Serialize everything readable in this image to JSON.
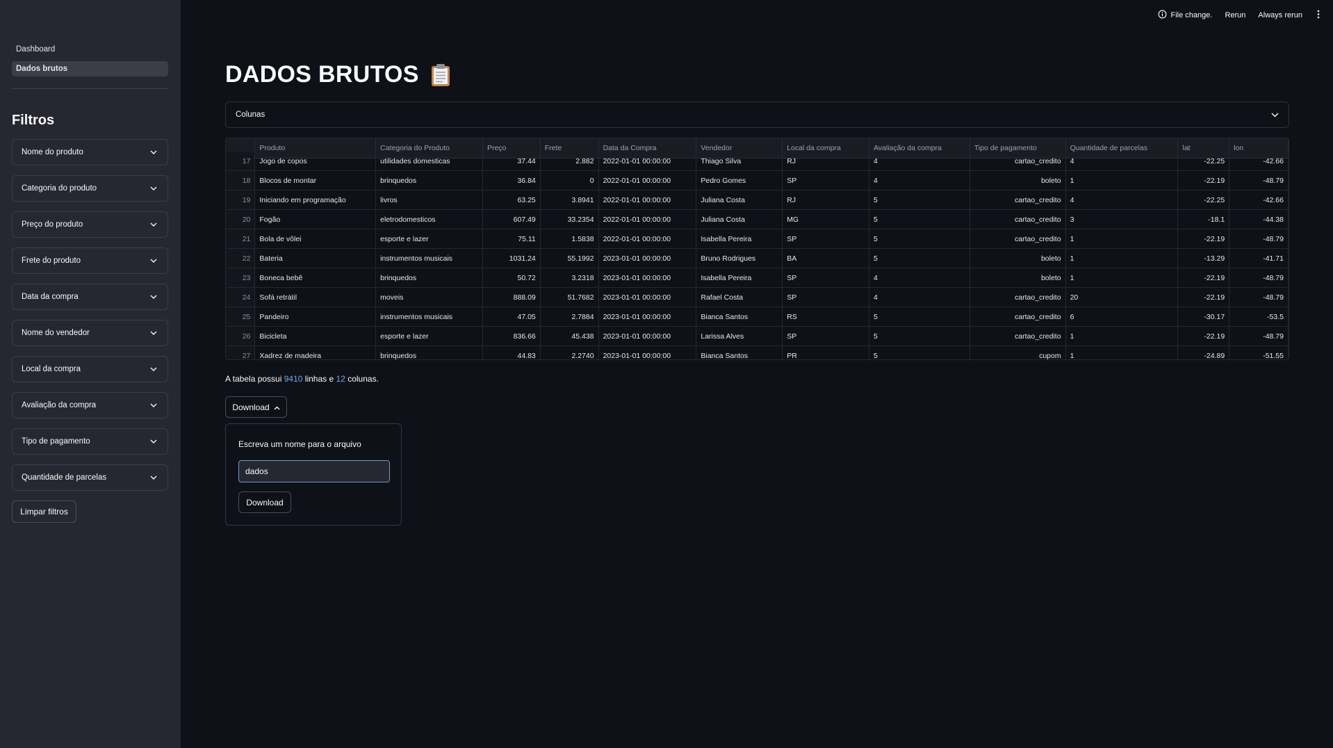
{
  "sidebar": {
    "nav": [
      "Dashboard",
      "Dados brutos"
    ],
    "filters_title": "Filtros",
    "filters": [
      "Nome do produto",
      "Categoria do produto",
      "Preço do produto",
      "Frete do produto",
      "Data da compra",
      "Nome do vendedor",
      "Local da compra",
      "Avaliação da compra",
      "Tipo de pagamento",
      "Quantidade de parcelas"
    ],
    "clear_button": "Limpar filtros"
  },
  "toolbar": {
    "status": "File change.",
    "rerun": "Rerun",
    "always_rerun": "Always rerun"
  },
  "main": {
    "title": "DADOS BRUTOS",
    "title_icon": "clipboard-icon",
    "expander_label": "Colunas",
    "table": {
      "columns": [
        "Produto",
        "Categoria do Produto",
        "Preço",
        "Frete",
        "Data da Compra",
        "Vendedor",
        "Local da compra",
        "Avaliação da compra",
        "Tipo de pagamento",
        "Quantidade de parcelas",
        "lat",
        "lon"
      ],
      "rows": [
        [
          "17",
          "Jogo de copos",
          "utilidades domesticas",
          "37.44",
          "2.882",
          "2022-01-01 00:00:00",
          "Thiago Silva",
          "RJ",
          "4",
          "cartao_credito",
          "4",
          "-22.25",
          "-42.66"
        ],
        [
          "18",
          "Blocos de montar",
          "brinquedos",
          "36.84",
          "0",
          "2022-01-01 00:00:00",
          "Pedro Gomes",
          "SP",
          "4",
          "boleto",
          "1",
          "-22.19",
          "-48.79"
        ],
        [
          "19",
          "Iniciando em programação",
          "livros",
          "63.25",
          "3.8941",
          "2022-01-01 00:00:00",
          "Juliana Costa",
          "RJ",
          "5",
          "cartao_credito",
          "4",
          "-22.25",
          "-42.66"
        ],
        [
          "20",
          "Fogão",
          "eletrodomesticos",
          "607.49",
          "33.2354",
          "2022-01-01 00:00:00",
          "Juliana Costa",
          "MG",
          "5",
          "cartao_credito",
          "3",
          "-18.1",
          "-44.38"
        ],
        [
          "21",
          "Bola de vôlei",
          "esporte e lazer",
          "75.11",
          "1.5838",
          "2022-01-01 00:00:00",
          "Isabella Pereira",
          "SP",
          "5",
          "cartao_credito",
          "1",
          "-22.19",
          "-48.79"
        ],
        [
          "22",
          "Bateria",
          "instrumentos musicais",
          "1031.24",
          "55.1992",
          "2023-01-01 00:00:00",
          "Bruno Rodrigues",
          "BA",
          "5",
          "boleto",
          "1",
          "-13.29",
          "-41.71"
        ],
        [
          "23",
          "Boneca bebê",
          "brinquedos",
          "50.72",
          "3.2318",
          "2023-01-01 00:00:00",
          "Isabella Pereira",
          "SP",
          "4",
          "boleto",
          "1",
          "-22.19",
          "-48.79"
        ],
        [
          "24",
          "Sofá retrátil",
          "moveis",
          "888.09",
          "51.7682",
          "2023-01-01 00:00:00",
          "Rafael Costa",
          "SP",
          "4",
          "cartao_credito",
          "20",
          "-22.19",
          "-48.79"
        ],
        [
          "25",
          "Pandeiro",
          "instrumentos musicais",
          "47.05",
          "2.7884",
          "2023-01-01 00:00:00",
          "Bianca Santos",
          "RS",
          "5",
          "cartao_credito",
          "6",
          "-30.17",
          "-53.5"
        ],
        [
          "26",
          "Bicicleta",
          "esporte e lazer",
          "836.66",
          "45.438",
          "2023-01-01 00:00:00",
          "Larissa Alves",
          "SP",
          "5",
          "cartao_credito",
          "1",
          "-22.19",
          "-48.79"
        ],
        [
          "27",
          "Xadrez de madeira",
          "brinquedos",
          "44.83",
          "2.2740",
          "2023-01-01 00:00:00",
          "Bianca Santos",
          "PR",
          "5",
          "cupom",
          "1",
          "-24.89",
          "-51.55"
        ]
      ]
    },
    "summary": {
      "prefix": "A tabela possui",
      "rows_count": "9410",
      "middle": "linhas e",
      "cols_count": "12",
      "suffix": "colunas."
    },
    "download_button": "Download",
    "popover": {
      "label": "Escreva um nome para o arquivo",
      "input_value": "dados",
      "button": "Download"
    }
  }
}
